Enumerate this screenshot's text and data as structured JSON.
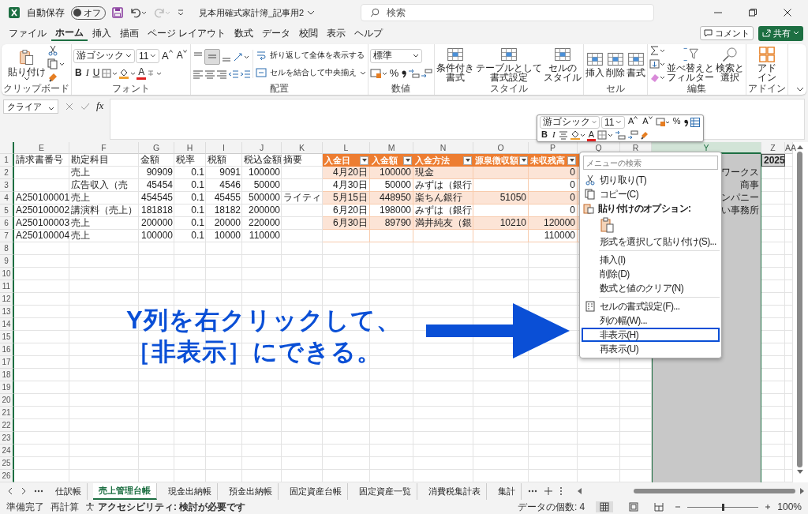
{
  "titlebar": {
    "autosave_label": "自動保存",
    "autosave_state": "オフ",
    "autosave_on": false,
    "filename": "見本用確式家計簿_記事用2",
    "search_placeholder": "検索"
  },
  "menu_tabs": [
    {
      "label": "ファイル",
      "selected": false
    },
    {
      "label": "ホーム",
      "selected": true
    },
    {
      "label": "挿入",
      "selected": false
    },
    {
      "label": "描画",
      "selected": false
    },
    {
      "label": "ページ レイアウト",
      "selected": false
    },
    {
      "label": "数式",
      "selected": false
    },
    {
      "label": "データ",
      "selected": false
    },
    {
      "label": "校閲",
      "selected": false
    },
    {
      "label": "表示",
      "selected": false
    },
    {
      "label": "ヘルプ",
      "selected": false
    }
  ],
  "comment_button": "コメント",
  "share_button": "共有",
  "ribbon": {
    "groups": [
      {
        "kind": "clipboard",
        "label": "クリップボード",
        "buttons": [
          {
            "lines": [
              "貼り付け"
            ]
          }
        ]
      },
      {
        "kind": "font",
        "label": "フォント",
        "font_name": "游ゴシック",
        "font_size": "11",
        "grow": "A",
        "shrink": "A",
        "bold": "B",
        "italic": "I",
        "underline": "U",
        "font_color_glyph": "A"
      },
      {
        "kind": "alignment",
        "label": "配置",
        "wrap": "折り返して全体を表示する",
        "merge": "セルを結合して中央揃え",
        "middle_selected": true
      },
      {
        "kind": "number",
        "label": "数値",
        "format": "標準",
        "percent": "%"
      },
      {
        "kind": "buttons",
        "label": "スタイル",
        "buttons": [
          {
            "lines": [
              "条件付き",
              "書式"
            ]
          },
          {
            "lines": [
              "テーブルとして",
              "書式設定"
            ]
          },
          {
            "lines": [
              "セルの",
              "スタイル"
            ]
          }
        ]
      },
      {
        "kind": "buttons",
        "label": "セル",
        "buttons": [
          {
            "lines": [
              "挿入"
            ]
          },
          {
            "lines": [
              "削除"
            ]
          },
          {
            "lines": [
              "書式"
            ]
          }
        ]
      },
      {
        "kind": "editing",
        "label": "編集",
        "buttons": [
          {
            "lines": [
              "並べ替えと",
              "フィルター"
            ]
          },
          {
            "lines": [
              "検索と",
              "選択"
            ]
          }
        ]
      },
      {
        "kind": "buttons",
        "label": "アドイン",
        "buttons": [
          {
            "lines": [
              "アド",
              "イン"
            ]
          }
        ]
      }
    ]
  },
  "formula_bar": {
    "name_box": "クライア",
    "fx": "fx"
  },
  "mini_toolbar": {
    "font_name": "游ゴシック",
    "font_size": "11",
    "grow": "A",
    "shrink": "A",
    "percent": "%",
    "bold": "B",
    "italic": "I",
    "font_color_glyph": "A"
  },
  "columns": [
    {
      "label": "E",
      "selected": false,
      "table": false
    },
    {
      "label": "F",
      "selected": false,
      "table": false
    },
    {
      "label": "G",
      "selected": false,
      "table": false
    },
    {
      "label": "H",
      "selected": false,
      "table": false
    },
    {
      "label": "I",
      "selected": false,
      "table": false
    },
    {
      "label": "J",
      "selected": false,
      "table": false
    },
    {
      "label": "K",
      "selected": false,
      "table": false
    },
    {
      "label": "L",
      "selected": false,
      "table": true
    },
    {
      "label": "M",
      "selected": false,
      "table": true
    },
    {
      "label": "N",
      "selected": false,
      "table": true
    },
    {
      "label": "O",
      "selected": false,
      "table": true
    },
    {
      "label": "P",
      "selected": false,
      "table": true
    },
    {
      "label": "Q",
      "selected": false,
      "table": true
    },
    {
      "label": "R",
      "selected": false,
      "table": false
    },
    {
      "label": "Y",
      "selected": true,
      "table": false
    },
    {
      "label": "Z",
      "selected": false,
      "table": false
    },
    {
      "label": "AA",
      "selected": false,
      "table": false
    }
  ],
  "rows": [
    {
      "number": "1",
      "cells": [
        {
          "kind": "text",
          "text": "請求書番号"
        },
        {
          "kind": "text",
          "text": "勘定科目"
        },
        {
          "kind": "text",
          "text": "金額"
        },
        {
          "kind": "text",
          "text": "税率"
        },
        {
          "kind": "text",
          "text": "税額"
        },
        {
          "kind": "text",
          "text": "税込金額"
        },
        {
          "kind": "text",
          "text": "摘要"
        },
        {
          "kind": "header",
          "text": "入金日"
        },
        {
          "kind": "header",
          "text": "入金額"
        },
        {
          "kind": "header",
          "text": "入金方法"
        },
        {
          "kind": "header",
          "text": "源泉徴収額"
        },
        {
          "kind": "header",
          "text": "未収残高"
        },
        null,
        null,
        null,
        {
          "kind": "bold_number",
          "text": "2025"
        },
        null
      ]
    },
    {
      "number": "2",
      "banded": true,
      "cells": [
        null,
        {
          "kind": "text",
          "text": "売上"
        },
        {
          "kind": "number",
          "text": "90909"
        },
        {
          "kind": "number",
          "text": "0.1"
        },
        {
          "kind": "number",
          "text": "9091"
        },
        {
          "kind": "number",
          "text": "100000"
        },
        null,
        {
          "kind": "number",
          "text": "4月20日"
        },
        {
          "kind": "number",
          "text": "100000"
        },
        {
          "kind": "text",
          "text": "現金"
        },
        null,
        {
          "kind": "number",
          "text": "0"
        },
        null,
        null,
        {
          "kind": "right_text",
          "text": "ワークス"
        },
        null,
        null
      ]
    },
    {
      "number": "3",
      "banded": false,
      "cells": [
        null,
        {
          "kind": "text",
          "text": "広告収入（売"
        },
        {
          "kind": "number",
          "text": "45454"
        },
        {
          "kind": "number",
          "text": "0.1"
        },
        {
          "kind": "number",
          "text": "4546"
        },
        {
          "kind": "number",
          "text": "50000"
        },
        null,
        {
          "kind": "number",
          "text": "4月30日"
        },
        {
          "kind": "number",
          "text": "50000"
        },
        {
          "kind": "text",
          "text": "みずは（銀行"
        },
        null,
        {
          "kind": "number",
          "text": "0"
        },
        null,
        null,
        {
          "kind": "right_text",
          "text": "商事"
        },
        null,
        null
      ]
    },
    {
      "number": "4",
      "banded": true,
      "cells": [
        {
          "kind": "text",
          "text": "A250100001"
        },
        {
          "kind": "text",
          "text": "売上"
        },
        {
          "kind": "number",
          "text": "454545"
        },
        {
          "kind": "number",
          "text": "0.1"
        },
        {
          "kind": "number",
          "text": "45455"
        },
        {
          "kind": "number",
          "text": "500000"
        },
        {
          "kind": "text",
          "text": "ライティ"
        },
        {
          "kind": "number",
          "text": "5月15日"
        },
        {
          "kind": "number",
          "text": "448950"
        },
        {
          "kind": "text",
          "text": "楽ちん銀行"
        },
        {
          "kind": "number",
          "text": "51050"
        },
        {
          "kind": "number",
          "text": "0"
        },
        null,
        null,
        {
          "kind": "right_text",
          "text": "ンパニー"
        },
        null,
        null
      ]
    },
    {
      "number": "5",
      "banded": false,
      "cells": [
        {
          "kind": "text",
          "text": "A250100002"
        },
        {
          "kind": "text",
          "text": "講演料（売上）"
        },
        {
          "kind": "number",
          "text": "181818"
        },
        {
          "kind": "number",
          "text": "0.1"
        },
        {
          "kind": "number",
          "text": "18182"
        },
        {
          "kind": "number",
          "text": "200000"
        },
        null,
        {
          "kind": "number",
          "text": "6月20日"
        },
        {
          "kind": "number",
          "text": "198000"
        },
        {
          "kind": "text",
          "text": "みずは（銀行"
        },
        null,
        {
          "kind": "number",
          "text": "0"
        },
        null,
        null,
        {
          "kind": "right_text",
          "text": "い事務所"
        },
        null,
        null
      ]
    },
    {
      "number": "6",
      "banded": true,
      "cells": [
        {
          "kind": "text",
          "text": "A250100003"
        },
        {
          "kind": "text",
          "text": "売上"
        },
        {
          "kind": "number",
          "text": "200000"
        },
        {
          "kind": "number",
          "text": "0.1"
        },
        {
          "kind": "number",
          "text": "20000"
        },
        {
          "kind": "number",
          "text": "220000"
        },
        null,
        {
          "kind": "number",
          "text": "6月30日"
        },
        {
          "kind": "number",
          "text": "89790"
        },
        {
          "kind": "text",
          "text": "満井純友（銀"
        },
        {
          "kind": "number",
          "text": "10210"
        },
        {
          "kind": "number",
          "text": "120000"
        },
        null,
        null,
        null,
        null,
        null
      ]
    },
    {
      "number": "7",
      "banded": false,
      "cells": [
        {
          "kind": "text",
          "text": "A250100004"
        },
        {
          "kind": "text",
          "text": "売上"
        },
        {
          "kind": "number",
          "text": "100000"
        },
        {
          "kind": "number",
          "text": "0.1"
        },
        {
          "kind": "number",
          "text": "10000"
        },
        {
          "kind": "number",
          "text": "110000"
        },
        null,
        null,
        null,
        null,
        null,
        {
          "kind": "number",
          "text": "110000"
        },
        null,
        null,
        null,
        null,
        null
      ]
    },
    {
      "number": "8"
    },
    {
      "number": "9"
    },
    {
      "number": "10"
    },
    {
      "number": "11"
    },
    {
      "number": "12"
    },
    {
      "number": "13"
    },
    {
      "number": "14"
    },
    {
      "number": "15"
    },
    {
      "number": "16"
    },
    {
      "number": "17"
    },
    {
      "number": "18"
    },
    {
      "number": "19"
    },
    {
      "number": "20"
    },
    {
      "number": "21"
    },
    {
      "number": "22"
    },
    {
      "number": "23"
    },
    {
      "number": "24"
    },
    {
      "number": "25"
    },
    {
      "number": "26"
    }
  ],
  "context_menu": {
    "search_placeholder": "メニューの検索",
    "items": [
      {
        "kind": "cut",
        "label": "切り取り(T)",
        "selected": false
      },
      {
        "kind": "copy",
        "label": "コピー(C)",
        "selected": false
      },
      {
        "kind": "paste_header",
        "label": "貼り付けのオプション:"
      },
      {
        "kind": "paste_options"
      },
      {
        "kind": "command",
        "label": "形式を選択して貼り付け(S)...",
        "selected": false
      },
      {
        "kind": "divider"
      },
      {
        "kind": "command",
        "label": "挿入(I)",
        "selected": false
      },
      {
        "kind": "command",
        "label": "削除(D)",
        "selected": false
      },
      {
        "kind": "command",
        "label": "数式と値のクリア(N)",
        "selected": false
      },
      {
        "kind": "divider"
      },
      {
        "kind": "format_cells",
        "label": "セルの書式設定(F)...",
        "selected": false
      },
      {
        "kind": "command",
        "label": "列の幅(W)...",
        "selected": false
      },
      {
        "kind": "command",
        "label": "非表示(H)",
        "selected": true
      },
      {
        "kind": "command",
        "label": "再表示(U)",
        "selected": false
      }
    ]
  },
  "annotation": {
    "lines": [
      "Y列を右クリックして、",
      "［非表示］にできる。"
    ]
  },
  "sheet_tabs": [
    {
      "label": "仕訳帳",
      "selected": false
    },
    {
      "label": "売上管理台帳",
      "selected": true
    },
    {
      "label": "現金出納帳",
      "selected": false
    },
    {
      "label": "預金出納帳",
      "selected": false
    },
    {
      "label": "固定資産台帳",
      "selected": false
    },
    {
      "label": "固定資産一覧",
      "selected": false
    },
    {
      "label": "消費税集計表",
      "selected": false
    },
    {
      "label": "集計",
      "selected": false
    }
  ],
  "status_bar": {
    "ready": "準備完了",
    "recalc": "再計算",
    "accessibility": "アクセシビリティ: 検討が必要です",
    "count": "データの個数: 4",
    "zoom": "100%",
    "zoom_slider": {
      "level": 0.5
    }
  }
}
